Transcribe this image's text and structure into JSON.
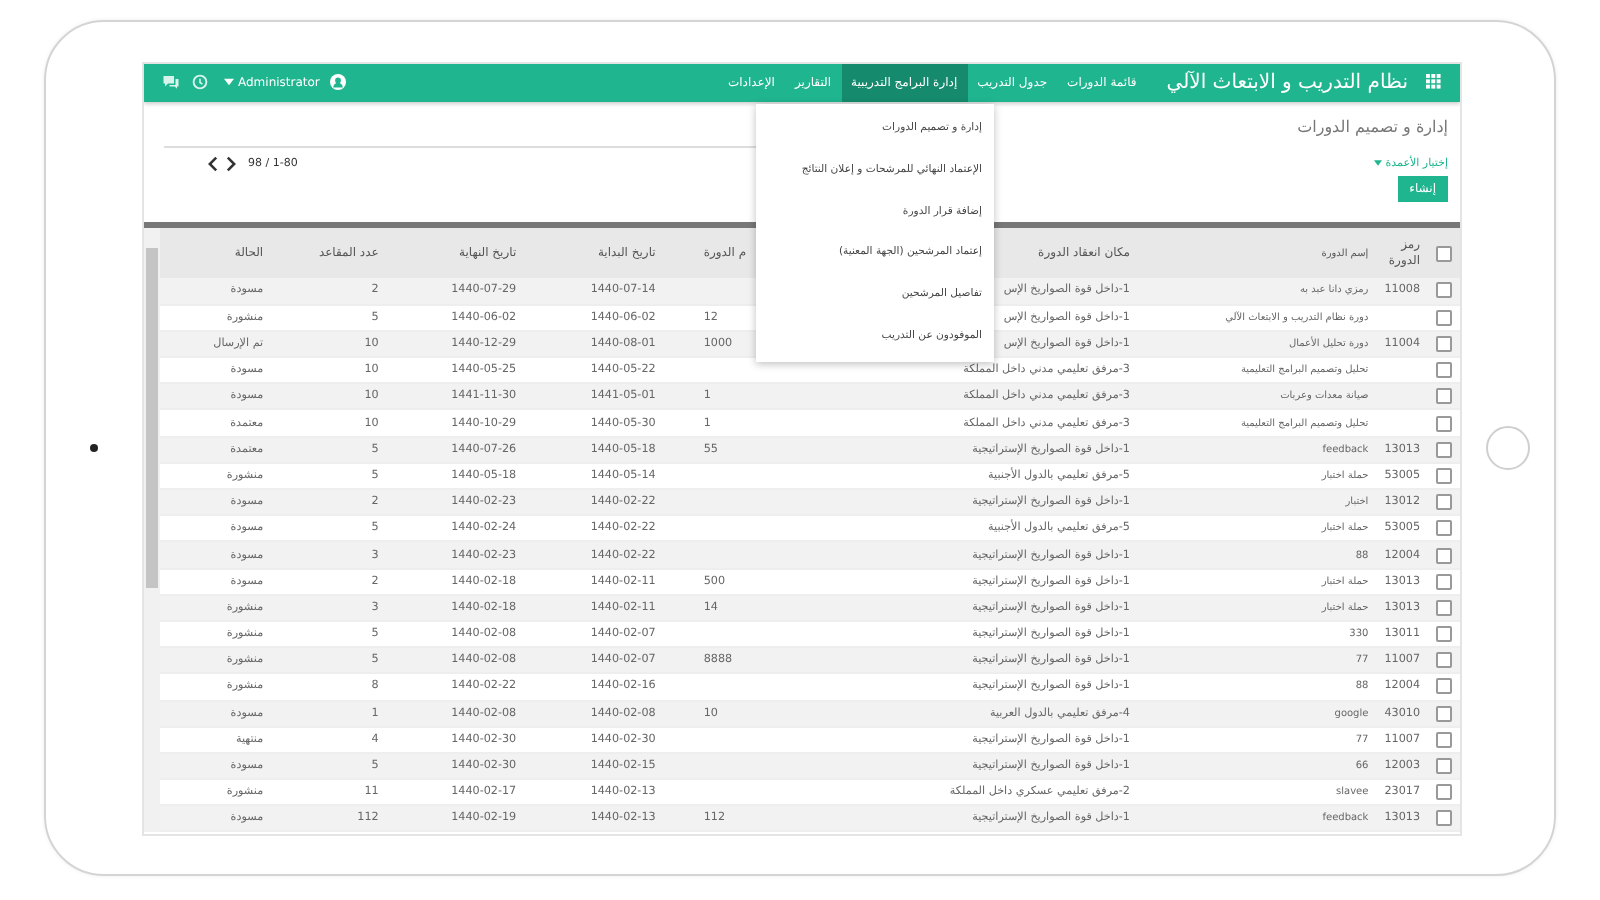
{
  "navbar": {
    "title": "نظام التدريب و الابتعاث الآلي",
    "user": "Administrator",
    "tabs": [
      {
        "label": "قائمة الدورات",
        "selected": false
      },
      {
        "label": "جدول التدريب",
        "selected": false
      },
      {
        "label": "إدارة البرامج التدريبية",
        "selected": true
      },
      {
        "label": "التقارير",
        "selected": false
      },
      {
        "label": "الإعدادات",
        "selected": false
      }
    ]
  },
  "dropdown": {
    "items": [
      "إدارة و تصميم الدورات",
      "الإعتماد النهائي للمرشحات و إعلان النتائج",
      "إضافة قرار الدورة",
      "إعتماد المرشحين (الجهة المعنية)",
      "تفاصيل المرشحين",
      "الموفودون عن التدريب"
    ]
  },
  "page": {
    "title": "إدارة و تصميم الدورات",
    "pager": "98 / 1-80",
    "columns_link": "إختيار الأعمدة",
    "create_button": "إنشاء"
  },
  "table": {
    "all_checked": false,
    "columns": [
      "رمز الدورة",
      "إسم الدورة",
      "مكان انعقاد الدورة",
      "م الدورة",
      "تاريخ البداية",
      "تاريخ النهاية",
      "عدد المقاعد",
      "الحالة"
    ],
    "rows": [
      {
        "checked": false,
        "code": "11008",
        "name": "رمزي دانا عبد به",
        "location": "1-داخل قوة الصواريخ الإس",
        "start_date": "1440-07-14",
        "end_date": "1440-07-29",
        "seats": "2",
        "status": "مسودة"
      },
      {
        "checked": false,
        "name": "دورة نظام التدريب و الابتعاث الآلي",
        "location": "1-داخل قوة الصواريخ الإس",
        "course_no": "12",
        "start_date": "1440-06-02",
        "end_date": "1440-06-02",
        "seats": "5",
        "status": "منشورة"
      },
      {
        "checked": false,
        "code": "11004",
        "name": "دورة تحليل الأعمال",
        "location": "1-داخل قوة الصواريخ الإس",
        "course_no": "1000",
        "start_date": "1440-08-01",
        "end_date": "1440-12-29",
        "seats": "10",
        "status": "تم الإرسال"
      },
      {
        "checked": false,
        "name": "تحليل وتصميم البرامج التعليمية",
        "location": "3-مرفق تعليمي مدني داخل المملكة",
        "start_date": "1440-05-22",
        "end_date": "1440-05-25",
        "seats": "10",
        "status": "مسودة"
      },
      {
        "checked": false,
        "name": "صيانة معدات وعربات",
        "location": "3-مرفق تعليمي مدني داخل المملكة",
        "course_no": "1",
        "start_date": "1441-05-01",
        "end_date": "1441-11-30",
        "seats": "10",
        "status": "مسودة"
      },
      {
        "checked": false,
        "name": "تحليل وتصميم البرامج التعليمية",
        "location": "3-مرفق تعليمي مدني داخل المملكة",
        "course_no": "1",
        "start_date": "1440-05-30",
        "end_date": "1440-10-29",
        "seats": "10",
        "status": "معتمدة"
      },
      {
        "checked": false,
        "code": "13013",
        "name": "feedback",
        "location": "1-داخل قوة الصواريخ الإستراتيجية",
        "course_no": "55",
        "start_date": "1440-05-18",
        "end_date": "1440-07-26",
        "seats": "5",
        "status": "معتمدة"
      },
      {
        "checked": false,
        "code": "53005",
        "name": "حملة اختبار",
        "location": "5-مرفق تعليمي بالدول الأجنبية",
        "start_date": "1440-05-14",
        "end_date": "1440-05-18",
        "seats": "5",
        "status": "منشورة"
      },
      {
        "checked": false,
        "code": "13012",
        "name": "اختبار",
        "location": "1-داخل قوة الصواريخ الإستراتيجية",
        "start_date": "1440-02-22",
        "end_date": "1440-02-23",
        "seats": "2",
        "status": "مسودة"
      },
      {
        "checked": false,
        "code": "53005",
        "name": "حملة اختبار",
        "location": "5-مرفق تعليمي بالدول الأجنبية",
        "start_date": "1440-02-22",
        "end_date": "1440-02-24",
        "seats": "5",
        "status": "مسودة"
      },
      {
        "checked": false,
        "code": "12004",
        "name": "88",
        "location": "1-داخل قوة الصواريخ الإستراتيجية",
        "start_date": "1440-02-22",
        "end_date": "1440-02-23",
        "seats": "3",
        "status": "مسودة"
      },
      {
        "checked": false,
        "code": "13013",
        "name": "حملة اختبار",
        "location": "1-داخل قوة الصواريخ الإستراتيجية",
        "course_no": "500",
        "start_date": "1440-02-11",
        "end_date": "1440-02-18",
        "seats": "2",
        "status": "مسودة"
      },
      {
        "checked": false,
        "code": "13013",
        "name": "حملة اختبار",
        "location": "1-داخل قوة الصواريخ الإستراتيجية",
        "course_no": "14",
        "start_date": "1440-02-11",
        "end_date": "1440-02-18",
        "seats": "3",
        "status": "منشورة"
      },
      {
        "checked": false,
        "code": "13011",
        "name": "330",
        "location": "1-داخل قوة الصواريخ الإستراتيجية",
        "start_date": "1440-02-07",
        "end_date": "1440-02-08",
        "seats": "5",
        "status": "منشورة"
      },
      {
        "checked": false,
        "code": "11007",
        "name": "77",
        "location": "1-داخل قوة الصواريخ الإستراتيجية",
        "course_no": "8888",
        "start_date": "1440-02-07",
        "end_date": "1440-02-08",
        "seats": "5",
        "status": "منشورة"
      },
      {
        "checked": false,
        "code": "12004",
        "name": "88",
        "location": "1-داخل قوة الصواريخ الإستراتيجية",
        "start_date": "1440-02-16",
        "end_date": "1440-02-22",
        "seats": "8",
        "status": "منشورة"
      },
      {
        "checked": false,
        "code": "43010",
        "name": "google",
        "location": "4-مرفق تعليمي بالدول العربية",
        "course_no": "10",
        "start_date": "1440-02-08",
        "end_date": "1440-02-08",
        "seats": "1",
        "status": "مسودة"
      },
      {
        "checked": false,
        "code": "11007",
        "name": "77",
        "location": "1-داخل قوة الصواريخ الإستراتيجية",
        "start_date": "1440-02-30",
        "end_date": "1440-02-30",
        "seats": "4",
        "status": "منتهية"
      },
      {
        "checked": false,
        "code": "12003",
        "name": "66",
        "location": "1-داخل قوة الصواريخ الإستراتيجية",
        "start_date": "1440-02-15",
        "end_date": "1440-02-30",
        "seats": "5",
        "status": "مسودة"
      },
      {
        "checked": false,
        "code": "23017",
        "name": "slavee",
        "location": "2-مرفق تعليمي عسكري داخل المملكة",
        "start_date": "1440-02-13",
        "end_date": "1440-02-17",
        "seats": "11",
        "status": "منشورة"
      },
      {
        "checked": false,
        "code": "13013",
        "name": "feedback",
        "location": "1-داخل قوة الصواريخ الإستراتيجية",
        "course_no": "112",
        "start_date": "1440-02-13",
        "end_date": "1440-02-19",
        "seats": "112",
        "status": "مسودة"
      }
    ]
  }
}
